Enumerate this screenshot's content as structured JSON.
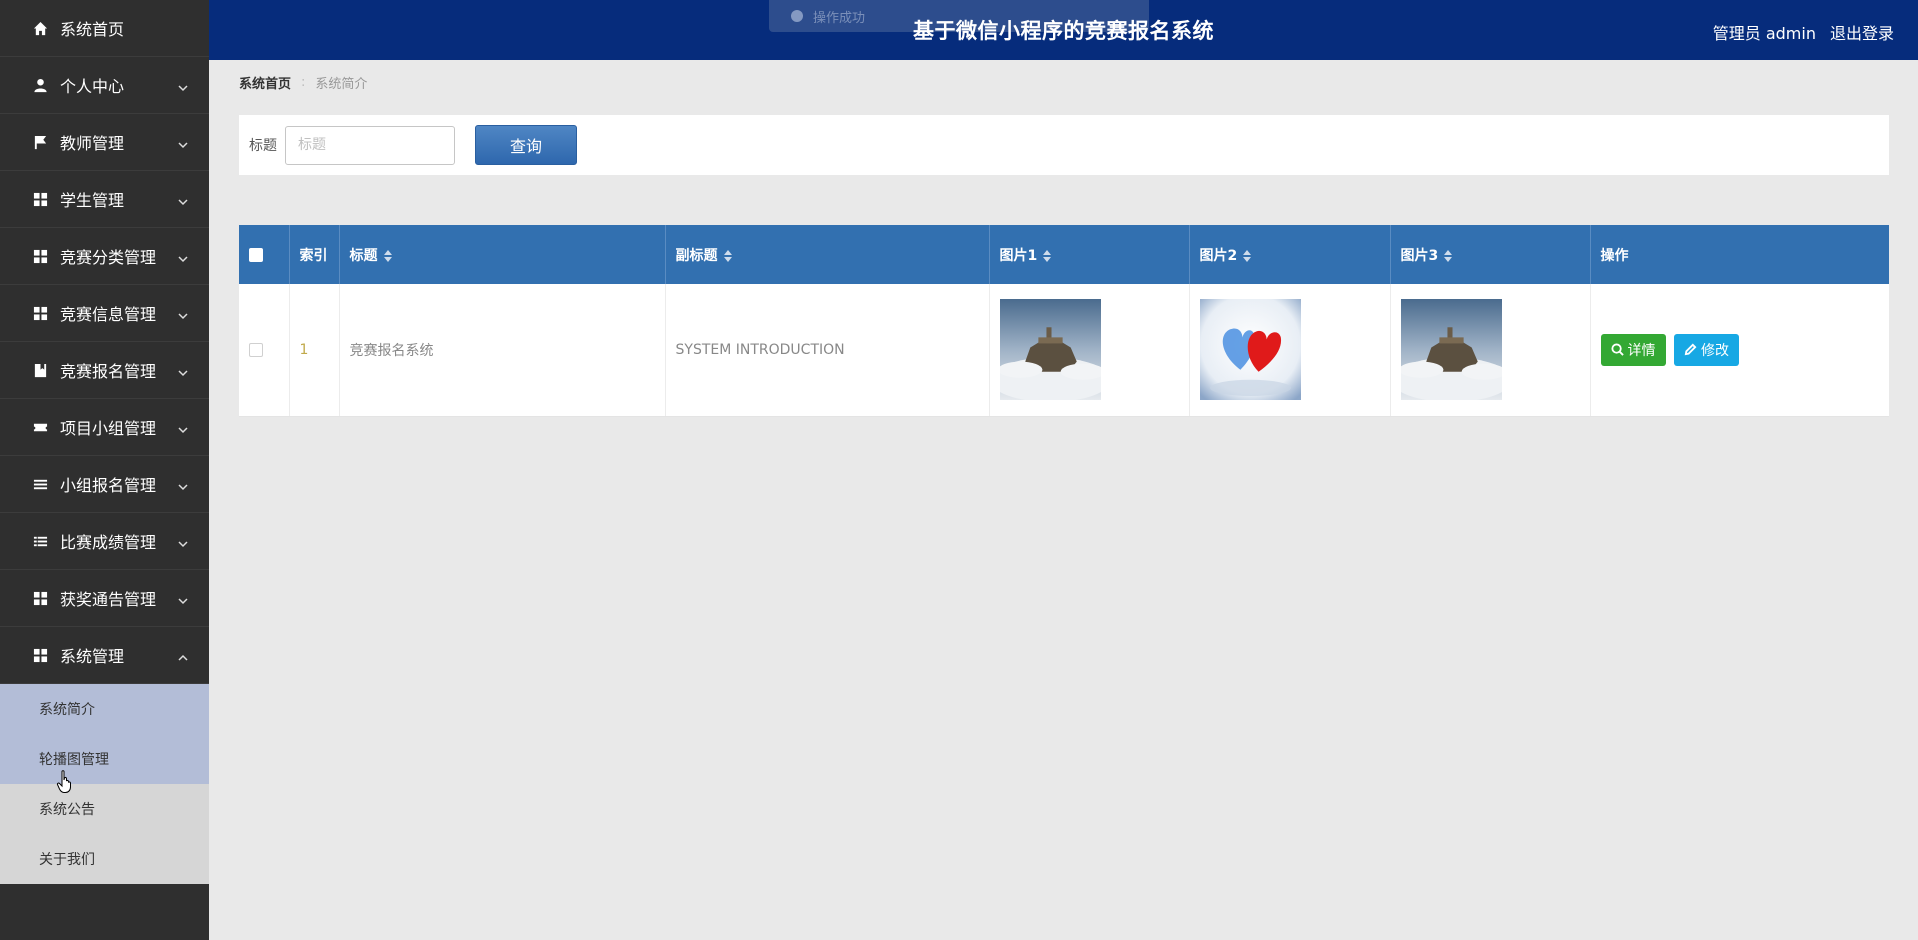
{
  "header": {
    "title": "基于微信小程序的竞赛报名系统",
    "role": "管理员 admin",
    "logout": "退出登录",
    "toast": "操作成功"
  },
  "sidebar": {
    "items": [
      {
        "label": "系统首页",
        "icon": "home-icon"
      },
      {
        "label": "个人中心",
        "icon": "user-icon"
      },
      {
        "label": "教师管理",
        "icon": "flag-icon"
      },
      {
        "label": "学生管理",
        "icon": "grid-icon"
      },
      {
        "label": "竞赛分类管理",
        "icon": "grid-icon"
      },
      {
        "label": "竞赛信息管理",
        "icon": "grid-icon"
      },
      {
        "label": "竞赛报名管理",
        "icon": "book-icon"
      },
      {
        "label": "项目小组管理",
        "icon": "ticket-icon"
      },
      {
        "label": "小组报名管理",
        "icon": "list-icon"
      },
      {
        "label": "比赛成绩管理",
        "icon": "list-icon"
      },
      {
        "label": "获奖通告管理",
        "icon": "grid-icon"
      },
      {
        "label": "系统管理",
        "icon": "grid-icon"
      }
    ],
    "submenu": [
      {
        "label": "系统简介"
      },
      {
        "label": "轮播图管理"
      },
      {
        "label": "系统公告"
      },
      {
        "label": "关于我们"
      }
    ]
  },
  "breadcrumb": {
    "home": "系统首页",
    "current": "系统简介"
  },
  "search": {
    "label": "标题",
    "placeholder": "标题",
    "button": "查询"
  },
  "table": {
    "headers": [
      "索引",
      "标题",
      "副标题",
      "图片1",
      "图片2",
      "图片3",
      "操作"
    ],
    "rows": [
      {
        "index": "1",
        "title": "竞赛报名系统",
        "subtitle": "SYSTEM INTRODUCTION",
        "images": [
          "castle-in-clouds",
          "blue-red-hearts",
          "castle-in-clouds"
        ],
        "actions": {
          "detail": "详情",
          "edit": "修改"
        }
      }
    ]
  },
  "colors": {
    "header_bg": "#062c7c",
    "sidebar_bg": "#2f2f2f",
    "table_head": "#3270b0",
    "detail_btn": "#33a833",
    "edit_btn": "#17a8e4"
  }
}
